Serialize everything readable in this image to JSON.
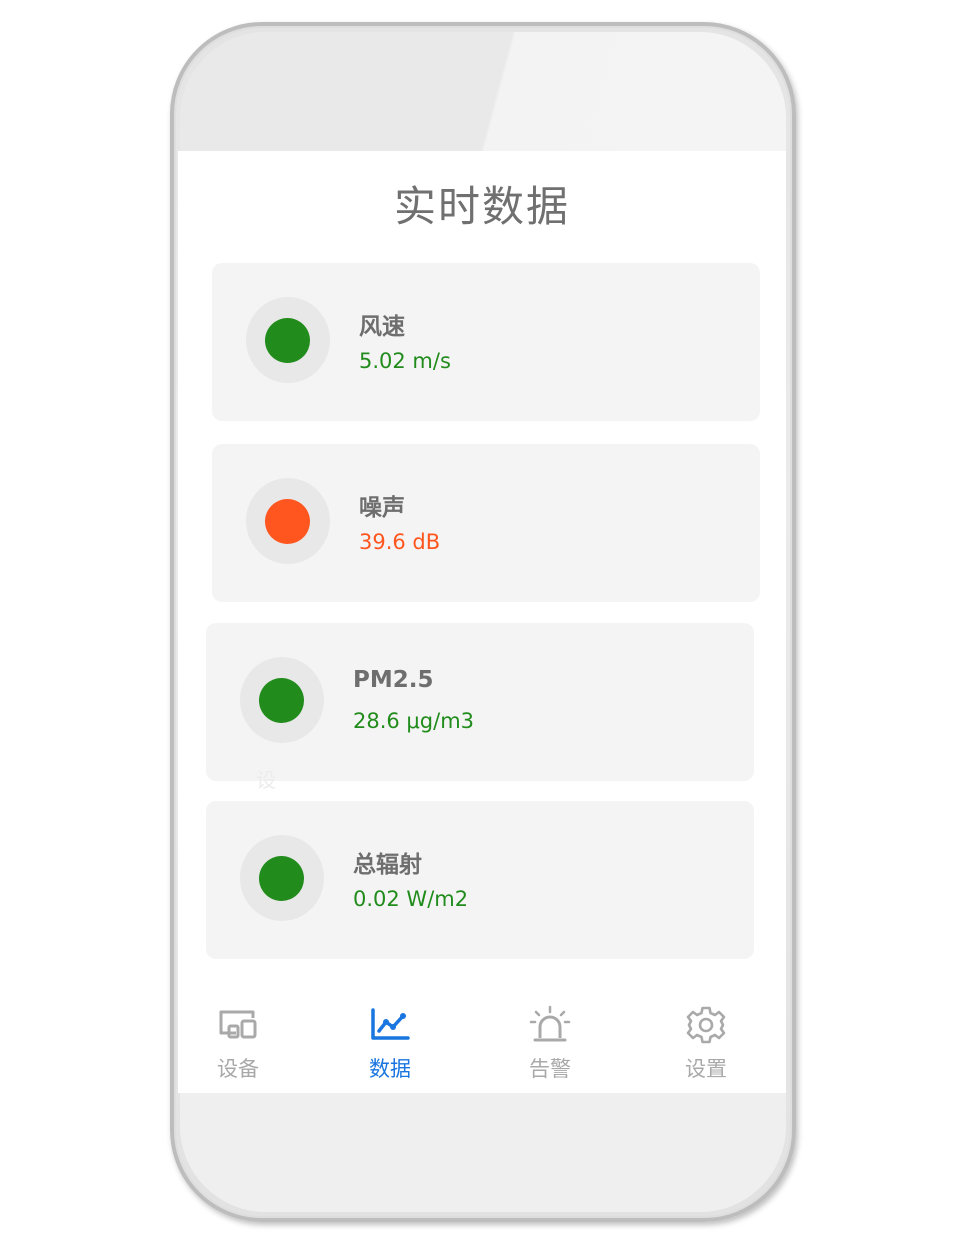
{
  "title": "实时数据",
  "colors": {
    "normal": "#218c1c",
    "warning": "#ff561f",
    "tab_active": "#1976e0",
    "tab_inactive": "#a9a9a9"
  },
  "cards": [
    {
      "label": "风速",
      "value": "5.02 m/s",
      "status": "normal",
      "indicator_color": "#218c1c"
    },
    {
      "label": "噪声",
      "value": "39.6 dB",
      "status": "warning",
      "indicator_color": "#ff561f"
    },
    {
      "label": "PM2.5",
      "value": "28.6 μg/m3",
      "status": "normal",
      "indicator_color": "#218c1c"
    },
    {
      "label": "总辐射",
      "value": "0.02 W/m2",
      "status": "normal",
      "indicator_color": "#218c1c"
    }
  ],
  "ghost_text": "设",
  "tabs": [
    {
      "label": "设备",
      "icon": "devices-icon",
      "active": false
    },
    {
      "label": "数据",
      "icon": "line-chart-icon",
      "active": true
    },
    {
      "label": "告警",
      "icon": "alarm-light-icon",
      "active": false
    },
    {
      "label": "设置",
      "icon": "gear-icon",
      "active": false
    }
  ]
}
